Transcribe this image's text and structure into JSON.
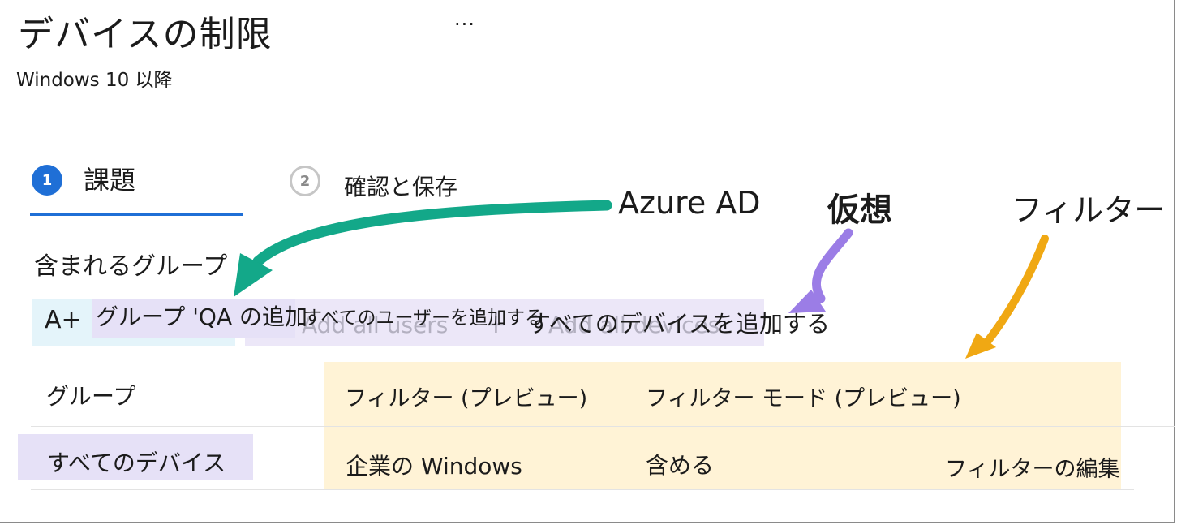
{
  "header": {
    "title": "デバイスの制限",
    "more_label": "···",
    "subtitle": "Windows 10 以降"
  },
  "steps": [
    {
      "number": "1",
      "label": "課題",
      "active": true
    },
    {
      "number": "2",
      "label": "確認と保存",
      "active": false
    }
  ],
  "annotations": {
    "azure_ad": "Azure AD",
    "virtual": "仮想",
    "filter": "フィルター"
  },
  "section": {
    "label": "含まれるグループ"
  },
  "toolbar": {
    "groups_icon": "A+",
    "add_groups_label": "グループ 'QA の追加",
    "add_all_users_label": "すべてのユーザーを追加する",
    "add_all_devices_label": "すべてのデバイスを追加する",
    "ghost_users": "Add all users",
    "ghost_plus": "+",
    "ghost_devices": "Add all devices"
  },
  "table": {
    "columns": {
      "group": "グループ",
      "filter": "フィルター (プレビュー)",
      "filter_mode": "フィルター モード (プレビュー)"
    },
    "rows": [
      {
        "group": "すべてのデバイス",
        "filter": "企業の Windows",
        "filter_mode": "含める",
        "edit_label": "フィルターの編集"
      }
    ]
  },
  "colors": {
    "accent": "#1f6fd6",
    "azure_arrow": "#13a889",
    "virtual_arrow": "#9b7de6",
    "filter_arrow": "#f0a813",
    "filter_highlight": "#fff3d6",
    "lavender_highlight": "#ece7f8"
  }
}
